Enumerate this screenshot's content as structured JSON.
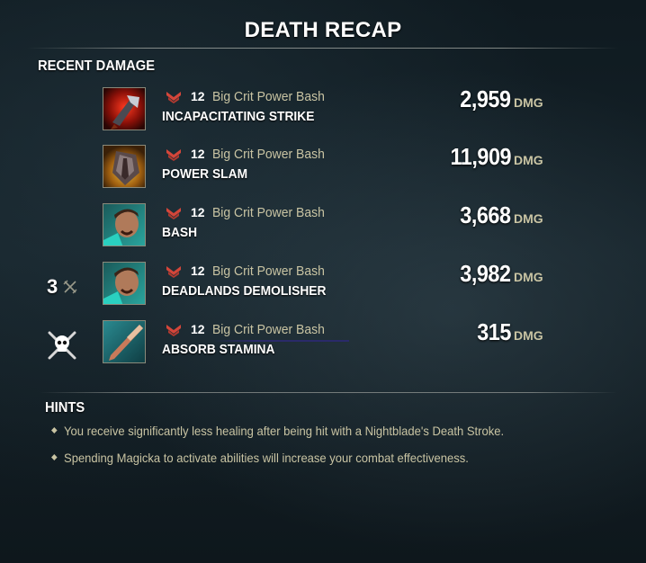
{
  "title": "DEATH RECAP",
  "recent_damage_label": "RECENT DAMAGE",
  "dmg_unit": "DMG",
  "attacks": [
    {
      "side_count": "",
      "side_icon": "",
      "icon": "incapacitating-strike-icon",
      "level": "12",
      "source": "Big Crit Power Bash",
      "ability": "INCAPACITATING STRIKE",
      "damage": "2,959"
    },
    {
      "side_count": "",
      "side_icon": "",
      "icon": "power-slam-icon",
      "level": "12",
      "source": "Big Crit Power Bash",
      "ability": "POWER SLAM",
      "damage": "11,909"
    },
    {
      "side_count": "",
      "side_icon": "",
      "icon": "bash-icon",
      "level": "12",
      "source": "Big Crit Power Bash",
      "ability": "BASH",
      "damage": "3,668"
    },
    {
      "side_count": "3",
      "side_icon": "crossed-swords-icon",
      "icon": "deadlands-demolisher-icon",
      "level": "12",
      "source": "Big Crit Power Bash",
      "ability": "DEADLANDS DEMOLISHER",
      "damage": "3,982"
    },
    {
      "side_count": "",
      "side_icon": "skull-crossbones-icon",
      "icon": "absorb-stamina-icon",
      "level": "12",
      "source": "Big Crit Power Bash",
      "ability": "ABSORB STAMINA",
      "damage": "315"
    }
  ],
  "hints_label": "HINTS",
  "hints": [
    "You receive significantly less healing after being hit with a Nightblade's Death Stroke.",
    "Spending Magicka to activate abilities will increase your combat effectiveness."
  ],
  "colors": {
    "accent_text": "#c9c4a3",
    "rank_icon": "#d4463a"
  }
}
